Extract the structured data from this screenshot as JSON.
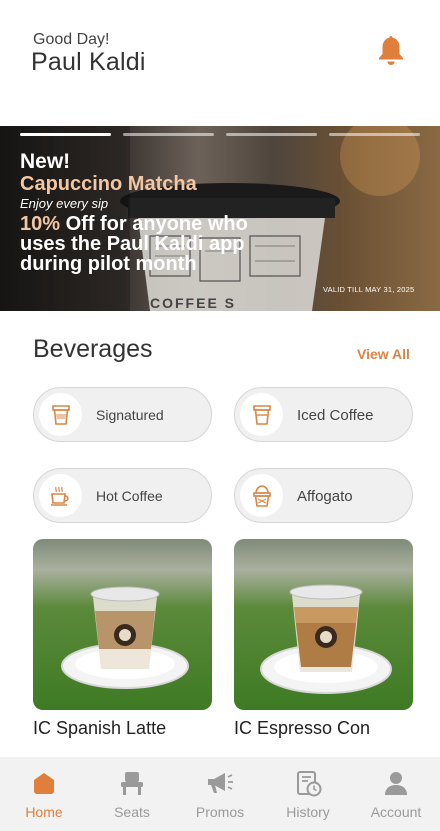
{
  "header": {
    "greeting": "Good Day!",
    "user_name": "Paul Kaldi"
  },
  "banner": {
    "new_label": "New!",
    "product_name": "Capuccino Matcha",
    "tagline": "Enjoy every sip",
    "offer_percent": "10%",
    "offer_text": " Off for anyone who uses the Paul Kaldi app during pilot month",
    "valid_text": "VALID TILL MAY 31, 2025",
    "slide_count": 4,
    "active_slide": 1
  },
  "beverages": {
    "title": "Beverages",
    "view_all": "View All",
    "categories": [
      {
        "label": "Signatured",
        "icon": "cup-icon"
      },
      {
        "label": "Iced Coffee",
        "icon": "iced-cup-icon"
      },
      {
        "label": "Hot Coffee",
        "icon": "hot-mug-icon"
      },
      {
        "label": "Affogato",
        "icon": "affogato-icon"
      }
    ],
    "products": [
      {
        "name": "IC Spanish Latte"
      },
      {
        "name": "IC Espresso Con"
      }
    ]
  },
  "tabbar": {
    "items": [
      {
        "label": "Home",
        "icon": "home-icon",
        "active": true
      },
      {
        "label": "Seats",
        "icon": "seat-icon",
        "active": false
      },
      {
        "label": "Promos",
        "icon": "megaphone-icon",
        "active": false
      },
      {
        "label": "History",
        "icon": "history-icon",
        "active": false
      },
      {
        "label": "Account",
        "icon": "user-icon",
        "active": false
      }
    ]
  },
  "colors": {
    "accent": "#e07e3c",
    "banner_highlight": "#f2c7a3",
    "inactive": "#9a9a9a"
  }
}
